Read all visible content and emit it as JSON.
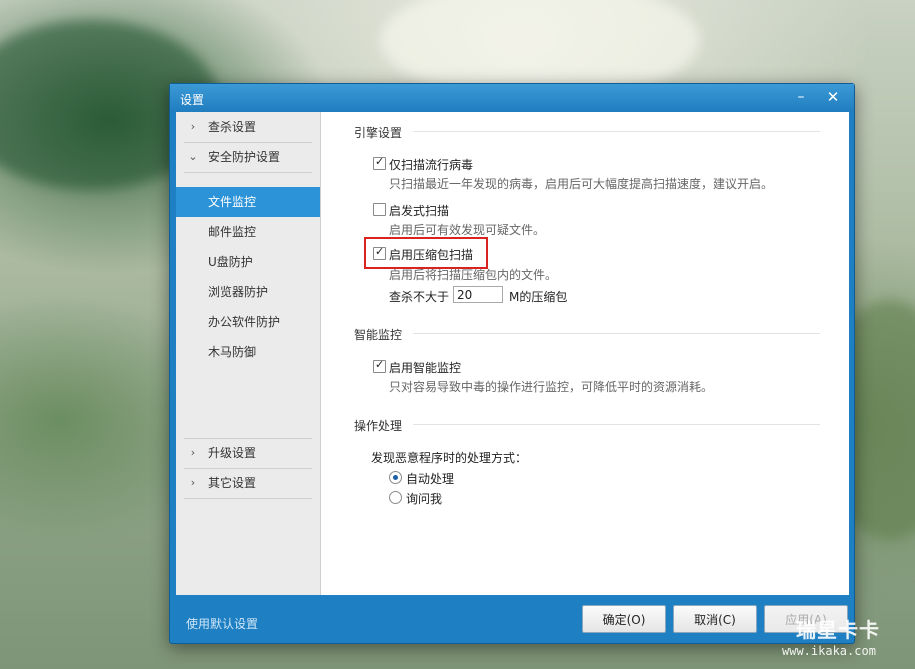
{
  "window": {
    "title": "设置",
    "minimize_glyph": "–",
    "close_glyph": "✕"
  },
  "sidebar": {
    "groups": [
      {
        "label": "查杀设置",
        "expanded": false,
        "icon": "chevron-right-icon"
      },
      {
        "label": "安全防护设置",
        "expanded": true,
        "icon": "chevron-down-icon"
      },
      {
        "label": "升级设置",
        "expanded": false,
        "icon": "chevron-right-icon"
      },
      {
        "label": "其它设置",
        "expanded": false,
        "icon": "chevron-right-icon"
      }
    ],
    "sub_items": [
      {
        "label": "文件监控",
        "active": true
      },
      {
        "label": "邮件监控",
        "active": false
      },
      {
        "label": "U盘防护",
        "active": false
      },
      {
        "label": "浏览器防护",
        "active": false
      },
      {
        "label": "办公软件防护",
        "active": false
      },
      {
        "label": "木马防御",
        "active": false
      }
    ]
  },
  "engine": {
    "section_title": "引擎设置",
    "popular_only": {
      "label": "仅扫描流行病毒",
      "checked": true,
      "desc": "只扫描最近一年发现的病毒，启用后可大幅度提高扫描速度，建议开启。"
    },
    "heuristic": {
      "label": "启发式扫描",
      "checked": false,
      "desc": "启用后可有效发现可疑文件。"
    },
    "archive": {
      "label": "启用压缩包扫描",
      "checked": true,
      "desc": "启用后将扫描压缩包内的文件。",
      "size_prefix": "查杀不大于",
      "size_value": "20",
      "size_suffix": "M的压缩包"
    }
  },
  "smart": {
    "section_title": "智能监控",
    "enable": {
      "label": "启用智能监控",
      "checked": true,
      "desc": "只对容易导致中毒的操作进行监控，可降低平时的资源消耗。"
    }
  },
  "action": {
    "section_title": "操作处理",
    "prompt": "发现恶意程序时的处理方式：",
    "options": [
      {
        "label": "自动处理",
        "selected": true
      },
      {
        "label": "询问我",
        "selected": false
      }
    ]
  },
  "footer": {
    "reset_link": "使用默认设置",
    "ok_label": "确定(O)",
    "cancel_label": "取消(C)",
    "apply_label": "应用(A)"
  },
  "watermark": {
    "main": "瑞星卡卡",
    "sub": "www.ikaka.com"
  },
  "colors": {
    "titlebar": "#1f7dc0",
    "active_item": "#2c93d8",
    "highlight_border": "#d9231f"
  }
}
